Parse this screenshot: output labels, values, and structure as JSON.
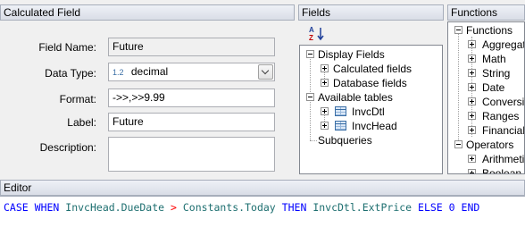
{
  "calc_field_panel": {
    "title": "Calculated Field",
    "field_name": {
      "label": "Field Name:",
      "value": "Future"
    },
    "data_type": {
      "label": "Data Type:",
      "type_icon": "1.2",
      "value": "decimal"
    },
    "format": {
      "label": "Format:",
      "value": "->>,>>9.99"
    },
    "display_label": {
      "label": "Label:",
      "value": "Future"
    },
    "description": {
      "label": "Description:",
      "value": ""
    }
  },
  "fields_panel": {
    "title": "Fields",
    "sort_icon": "sort-az-icon",
    "tree": {
      "display_fields": "Display Fields",
      "calculated_fields": "Calculated fields",
      "database_fields": "Database fields",
      "available_tables": "Available tables",
      "tables": [
        "InvcDtl",
        "InvcHead"
      ],
      "subqueries": "Subqueries"
    }
  },
  "functions_panel": {
    "title": "Functions",
    "functions_root": "Functions",
    "function_items": [
      "Aggregate",
      "Math",
      "String",
      "Date",
      "Conversion",
      "Ranges",
      "Financial"
    ],
    "operators_root": "Operators",
    "operator_items": [
      "Arithmetic",
      "Boolean"
    ]
  },
  "editor_panel": {
    "title": "Editor",
    "tokens": [
      {
        "t": "CASE",
        "c": "kw"
      },
      {
        "t": " ",
        "c": ""
      },
      {
        "t": "WHEN",
        "c": "kw"
      },
      {
        "t": " ",
        "c": ""
      },
      {
        "t": "InvcHead.DueDate",
        "c": "id"
      },
      {
        "t": " ",
        "c": ""
      },
      {
        "t": ">",
        "c": "op"
      },
      {
        "t": " ",
        "c": ""
      },
      {
        "t": "Constants.Today",
        "c": "id"
      },
      {
        "t": " ",
        "c": ""
      },
      {
        "t": "THEN",
        "c": "kw"
      },
      {
        "t": " ",
        "c": ""
      },
      {
        "t": "InvcDtl.ExtPrice",
        "c": "id"
      },
      {
        "t": " ",
        "c": ""
      },
      {
        "t": "ELSE",
        "c": "kw"
      },
      {
        "t": " ",
        "c": ""
      },
      {
        "t": "0",
        "c": "kw"
      },
      {
        "t": " ",
        "c": ""
      },
      {
        "t": "END",
        "c": "kw"
      }
    ]
  },
  "colors": {
    "keyword": "#0000ff",
    "identifier": "#1e6f70",
    "operator": "#ff0000"
  }
}
